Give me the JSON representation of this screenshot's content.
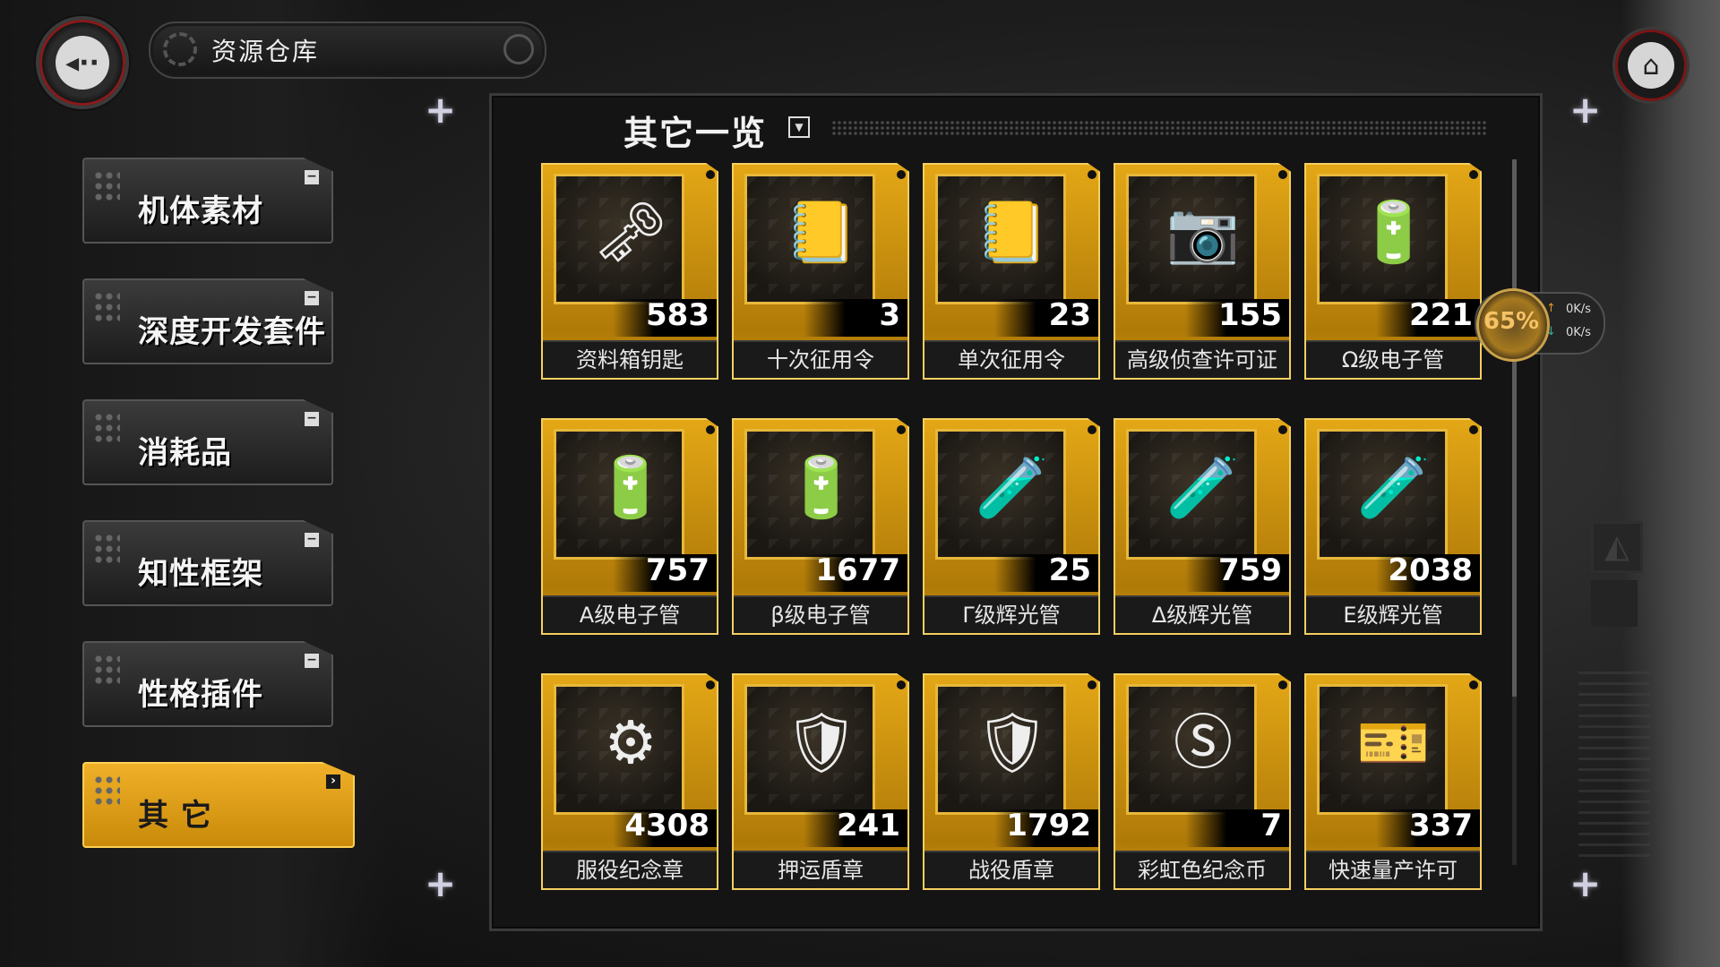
{
  "header": {
    "title": "资源仓库"
  },
  "sidebar": {
    "items": [
      {
        "label": "机体素材"
      },
      {
        "label": "深度开发套件"
      },
      {
        "label": "消耗品"
      },
      {
        "label": "知性框架"
      },
      {
        "label": "性格插件"
      },
      {
        "label": "其 它"
      }
    ],
    "active_index": 5
  },
  "panel": {
    "title": "其它一览"
  },
  "items": [
    {
      "name": "资料箱钥匙",
      "count": "583",
      "icon": "key-icon"
    },
    {
      "name": "十次征用令",
      "count": "3",
      "icon": "secret-document-icon"
    },
    {
      "name": "单次征用令",
      "count": "23",
      "icon": "secret-document-icon"
    },
    {
      "name": "高级侦查许可证",
      "count": "155",
      "icon": "camera-permit-icon"
    },
    {
      "name": "Ω级电子管",
      "count": "221",
      "icon": "vacuum-tube-icon"
    },
    {
      "name": "A级电子管",
      "count": "757",
      "icon": "vacuum-tube-icon"
    },
    {
      "name": "β级电子管",
      "count": "1677",
      "icon": "vacuum-tube-icon"
    },
    {
      "name": "Γ级辉光管",
      "count": "25",
      "icon": "nixie-tube-icon"
    },
    {
      "name": "Δ级辉光管",
      "count": "759",
      "icon": "nixie-tube-icon"
    },
    {
      "name": "Ε级辉光管",
      "count": "2038",
      "icon": "nixie-tube-icon"
    },
    {
      "name": "服役纪念章",
      "count": "4308",
      "icon": "gear-medal-icon"
    },
    {
      "name": "押运盾章",
      "count": "241",
      "icon": "shield-badge-icon"
    },
    {
      "name": "战役盾章",
      "count": "1792",
      "icon": "shield-badge-icon"
    },
    {
      "name": "彩虹色纪念币",
      "count": "7",
      "icon": "rainbow-coin-icon"
    },
    {
      "name": "快速量产许可",
      "count": "337",
      "icon": "gear-ticket-icon"
    }
  ],
  "network": {
    "percent": "65%",
    "upload": "0K/s",
    "download": "0K/s"
  },
  "colors": {
    "accent": "#e3a716",
    "panel": "#141414"
  }
}
